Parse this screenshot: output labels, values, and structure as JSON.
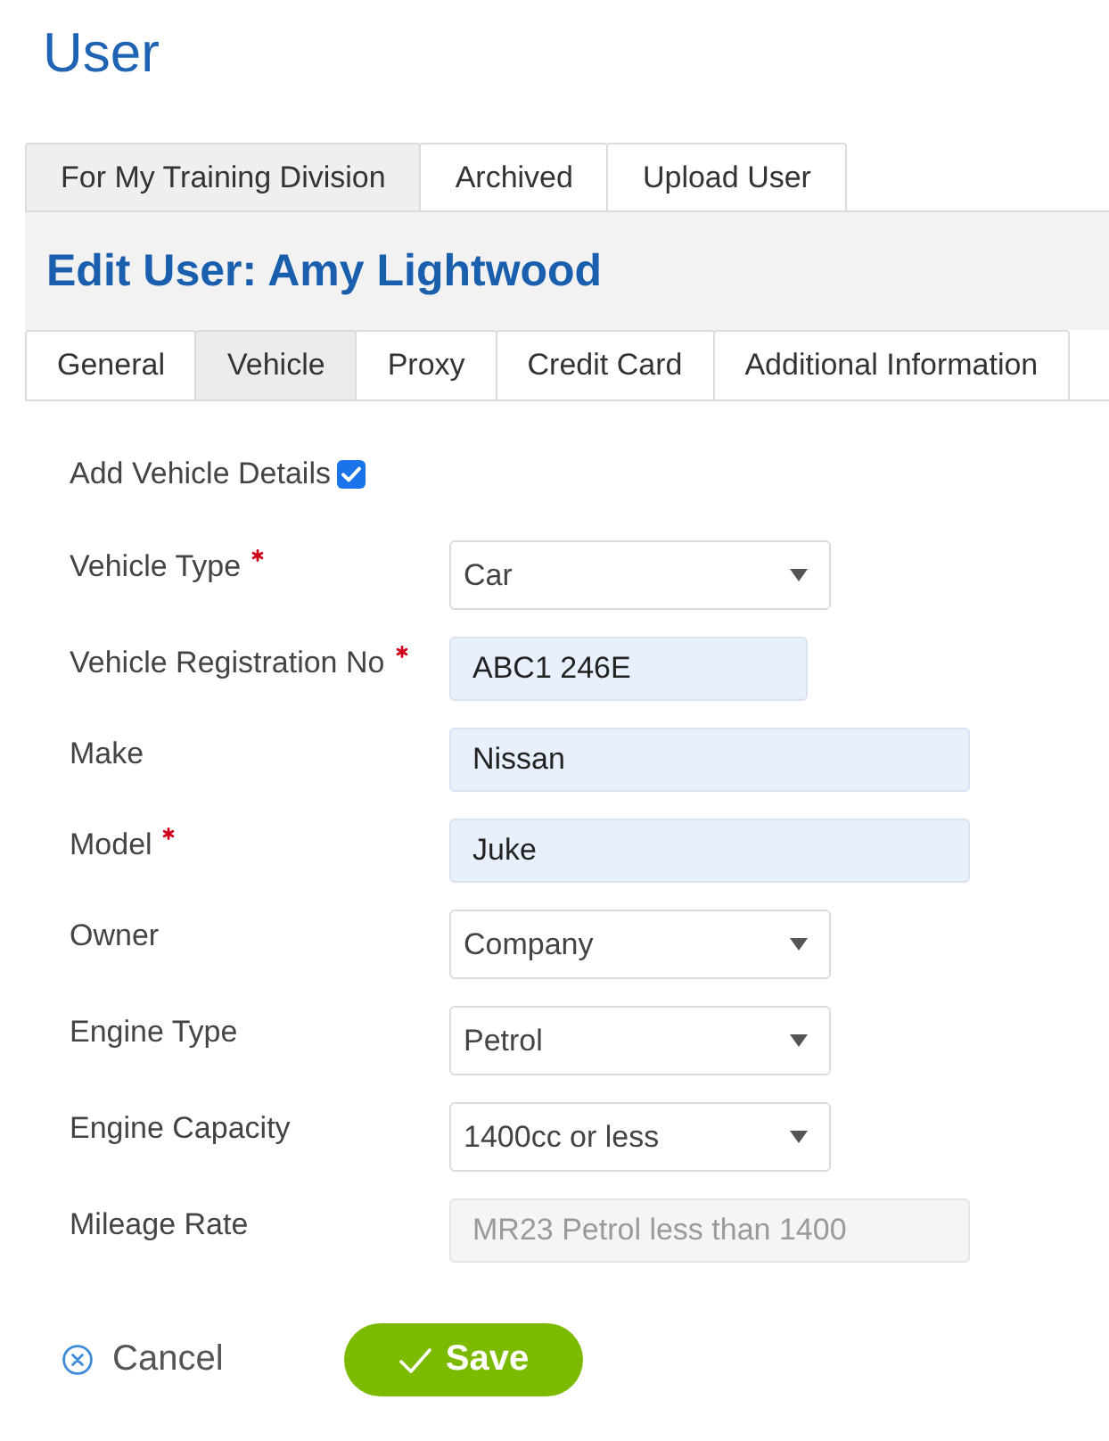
{
  "page": {
    "title": "User"
  },
  "top_tabs": [
    {
      "label": "For My Training Division",
      "selected": true
    },
    {
      "label": "Archived",
      "selected": false
    },
    {
      "label": "Upload User",
      "selected": false
    }
  ],
  "edit_header": {
    "title": "Edit User: Amy Lightwood"
  },
  "tabs": [
    {
      "label": "General",
      "selected": false
    },
    {
      "label": "Vehicle",
      "selected": true
    },
    {
      "label": "Proxy",
      "selected": false
    },
    {
      "label": "Credit Card",
      "selected": false
    },
    {
      "label": "Additional Information",
      "selected": false
    }
  ],
  "add_vehicle_details": {
    "label": "Add Vehicle Details",
    "checked": true
  },
  "fields": [
    {
      "kind": "select",
      "label": "Vehicle Type",
      "required": true,
      "disabled": false,
      "value": "Car"
    },
    {
      "kind": "text",
      "label": "Vehicle Registration No",
      "required": true,
      "disabled": false,
      "value": "ABC1 246E"
    },
    {
      "kind": "text",
      "label": "Make",
      "required": false,
      "disabled": false,
      "value": "Nissan"
    },
    {
      "kind": "text",
      "label": "Model",
      "required": true,
      "disabled": false,
      "value": "Juke"
    },
    {
      "kind": "select",
      "label": "Owner",
      "required": false,
      "disabled": false,
      "value": "Company"
    },
    {
      "kind": "select",
      "label": "Engine Type",
      "required": false,
      "disabled": false,
      "value": "Petrol"
    },
    {
      "kind": "select",
      "label": "Engine Capacity",
      "required": false,
      "disabled": false,
      "value": "1400cc or less"
    },
    {
      "kind": "text",
      "label": "Mileage Rate",
      "required": false,
      "disabled": true,
      "value": "MR23 Petrol less than 1400"
    }
  ],
  "actions": [
    {
      "kind": "cancel",
      "label": "Cancel"
    },
    {
      "kind": "save",
      "label": "Save"
    }
  ]
}
